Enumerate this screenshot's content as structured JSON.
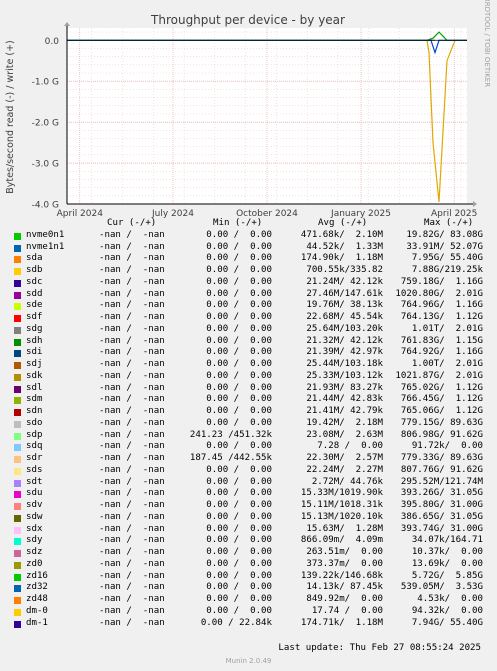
{
  "chart_data": {
    "type": "line",
    "title": "Throughput per device - by year",
    "ylabel": "Bytes/second read (-) / write (+)",
    "side_label": "RRDTOOL / TOBI OETIKER",
    "y_ticks": [
      {
        "v": 0,
        "label": "0.0"
      },
      {
        "v": -1,
        "label": "-1.0 G"
      },
      {
        "v": -2,
        "label": "-2.0 G"
      },
      {
        "v": -3,
        "label": "-3.0 G"
      },
      {
        "v": -4,
        "label": "-4.0 G"
      }
    ],
    "ylim": [
      -4,
      0.3
    ],
    "x_ticks": [
      "April 2024",
      "July 2024",
      "October 2024",
      "January 2025",
      "April 2025"
    ],
    "x_tick_fracs": [
      0.032,
      0.265,
      0.5,
      0.735,
      0.968
    ],
    "grid": true,
    "series": [
      {
        "name": "sda read",
        "color": "#e0a800",
        "x": [
          0.0,
          0.9,
          0.905,
          0.915,
          0.93,
          0.95,
          0.97,
          1.0
        ],
        "values": [
          0.0,
          0.0,
          -0.3,
          -2.5,
          -3.95,
          -0.5,
          0.0,
          0.0
        ]
      },
      {
        "name": "sda write",
        "color": "#00a000",
        "x": [
          0.0,
          0.9,
          0.915,
          0.93,
          0.95,
          1.0
        ],
        "values": [
          0.0,
          0.0,
          0.05,
          0.2,
          0.0,
          0.0
        ]
      },
      {
        "name": "nvme read",
        "color": "#0044cc",
        "x": [
          0.0,
          0.91,
          0.92,
          0.93,
          1.0
        ],
        "values": [
          0.0,
          0.0,
          -0.3,
          0.0,
          0.0
        ]
      }
    ],
    "legend_headers": {
      "cur": "Cur (-/+)",
      "min": "Min (-/+)",
      "avg": "Avg (-/+)",
      "max": "Max (-/+)"
    },
    "legend": [
      {
        "name": "nvme0n1",
        "color": "#00cc00",
        "cur": "-nan /  -nan",
        "min": "0.00 /  0.00",
        "avg": "471.68k/  2.10M",
        "max": "19.82G/ 83.08G"
      },
      {
        "name": "nvme1n1",
        "color": "#0066b3",
        "cur": "-nan /  -nan",
        "min": "0.00 /  0.00",
        "avg": "44.52k/  1.33M",
        "max": "33.91M/ 52.07G"
      },
      {
        "name": "sda",
        "color": "#ff8000",
        "cur": "-nan /  -nan",
        "min": "0.00 /  0.00",
        "avg": "174.90k/  1.18M",
        "max": "7.95G/ 55.40G"
      },
      {
        "name": "sdb",
        "color": "#ffcc00",
        "cur": "-nan /  -nan",
        "min": "0.00 /  0.00",
        "avg": "700.55k/335.82",
        "max": "7.88G/219.25k"
      },
      {
        "name": "sdc",
        "color": "#330099",
        "cur": "-nan /  -nan",
        "min": "0.00 /  0.00",
        "avg": "21.24M/ 42.12k",
        "max": "759.18G/  1.16G"
      },
      {
        "name": "sdd",
        "color": "#990099",
        "cur": "-nan /  -nan",
        "min": "0.00 /  0.00",
        "avg": "27.46M/147.61k",
        "max": "1020.80G/  2.01G"
      },
      {
        "name": "sde",
        "color": "#ccff00",
        "cur": "-nan /  -nan",
        "min": "0.00 /  0.00",
        "avg": "19.76M/ 38.13k",
        "max": "764.96G/  1.16G"
      },
      {
        "name": "sdf",
        "color": "#ff0000",
        "cur": "-nan /  -nan",
        "min": "0.00 /  0.00",
        "avg": "22.68M/ 45.54k",
        "max": "764.13G/  1.12G"
      },
      {
        "name": "sdg",
        "color": "#808080",
        "cur": "-nan /  -nan",
        "min": "0.00 /  0.00",
        "avg": "25.64M/103.20k",
        "max": "1.01T/  2.01G"
      },
      {
        "name": "sdh",
        "color": "#008f00",
        "cur": "-nan /  -nan",
        "min": "0.00 /  0.00",
        "avg": "21.32M/ 42.12k",
        "max": "761.83G/  1.15G"
      },
      {
        "name": "sdi",
        "color": "#00487d",
        "cur": "-nan /  -nan",
        "min": "0.00 /  0.00",
        "avg": "21.39M/ 42.97k",
        "max": "764.92G/  1.16G"
      },
      {
        "name": "sdj",
        "color": "#b35a00",
        "cur": "-nan /  -nan",
        "min": "0.00 /  0.00",
        "avg": "25.44M/103.18k",
        "max": "1.00T/  2.01G"
      },
      {
        "name": "sdk",
        "color": "#b38f00",
        "cur": "-nan /  -nan",
        "min": "0.00 /  0.00",
        "avg": "25.33M/103.12k",
        "max": "1021.87G/  2.01G"
      },
      {
        "name": "sdl",
        "color": "#6b006b",
        "cur": "-nan /  -nan",
        "min": "0.00 /  0.00",
        "avg": "21.93M/ 83.27k",
        "max": "765.02G/  1.12G"
      },
      {
        "name": "sdm",
        "color": "#8fb300",
        "cur": "-nan /  -nan",
        "min": "0.00 /  0.00",
        "avg": "21.44M/ 42.83k",
        "max": "766.45G/  1.12G"
      },
      {
        "name": "sdn",
        "color": "#b30000",
        "cur": "-nan /  -nan",
        "min": "0.00 /  0.00",
        "avg": "21.41M/ 42.79k",
        "max": "765.06G/  1.12G"
      },
      {
        "name": "sdo",
        "color": "#bebebe",
        "cur": "-nan /  -nan",
        "min": "0.00 /  0.00",
        "avg": "19.42M/  2.18M",
        "max": "779.15G/ 89.63G"
      },
      {
        "name": "sdp",
        "color": "#80ff80",
        "cur": "-nan /  -nan",
        "min": "241.23 /451.32k",
        "avg": "23.08M/  2.63M",
        "max": "806.98G/ 91.62G"
      },
      {
        "name": "sdq",
        "color": "#80c9ff",
        "cur": "-nan /  -nan",
        "min": "0.00 /  0.00",
        "avg": "7.28 /  0.00",
        "max": "91.72k/  0.00"
      },
      {
        "name": "sdr",
        "color": "#ffc080",
        "cur": "-nan /  -nan",
        "min": "187.45 /442.55k",
        "avg": "22.30M/  2.57M",
        "max": "779.33G/ 89.63G"
      },
      {
        "name": "sds",
        "color": "#ffe680",
        "cur": "-nan /  -nan",
        "min": "0.00 /  0.00",
        "avg": "22.24M/  2.27M",
        "max": "807.76G/ 91.62G"
      },
      {
        "name": "sdt",
        "color": "#aa80ff",
        "cur": "-nan /  -nan",
        "min": "0.00 /  0.00",
        "avg": "2.72M/ 44.76k",
        "max": "295.52M/121.74M"
      },
      {
        "name": "sdu",
        "color": "#ee00cc",
        "cur": "-nan /  -nan",
        "min": "0.00 /  0.00",
        "avg": "15.33M/1019.90k",
        "max": "393.26G/ 31.05G"
      },
      {
        "name": "sdv",
        "color": "#ff8080",
        "cur": "-nan /  -nan",
        "min": "0.00 /  0.00",
        "avg": "15.11M/1018.31k",
        "max": "395.80G/ 31.00G"
      },
      {
        "name": "sdw",
        "color": "#666600",
        "cur": "-nan /  -nan",
        "min": "0.00 /  0.00",
        "avg": "15.13M/1020.10k",
        "max": "386.65G/ 31.05G"
      },
      {
        "name": "sdx",
        "color": "#ffbfff",
        "cur": "-nan /  -nan",
        "min": "0.00 /  0.00",
        "avg": "15.63M/  1.28M",
        "max": "393.74G/ 31.00G"
      },
      {
        "name": "sdy",
        "color": "#00ffcc",
        "cur": "-nan /  -nan",
        "min": "0.00 /  0.00",
        "avg": "866.09m/  4.09m",
        "max": "34.07k/164.71"
      },
      {
        "name": "sdz",
        "color": "#cc6699",
        "cur": "-nan /  -nan",
        "min": "0.00 /  0.00",
        "avg": "263.51m/  0.00",
        "max": "10.37k/  0.00"
      },
      {
        "name": "zd0",
        "color": "#999900",
        "cur": "-nan /  -nan",
        "min": "0.00 /  0.00",
        "avg": "373.37m/  0.00",
        "max": "13.69k/  0.00"
      },
      {
        "name": "zd16",
        "color": "#00cc00",
        "cur": "-nan /  -nan",
        "min": "0.00 /  0.00",
        "avg": "139.22k/146.68k",
        "max": "5.72G/  5.85G"
      },
      {
        "name": "zd32",
        "color": "#0066b3",
        "cur": "-nan /  -nan",
        "min": "0.00 /  0.00",
        "avg": "14.13k/ 87.45k",
        "max": "539.05M/  3.53G"
      },
      {
        "name": "zd48",
        "color": "#ff8000",
        "cur": "-nan /  -nan",
        "min": "0.00 /  0.00",
        "avg": "849.92m/  0.00",
        "max": "4.53k/  0.00"
      },
      {
        "name": "dm-0",
        "color": "#ffcc00",
        "cur": "-nan /  -nan",
        "min": "0.00 /  0.00",
        "avg": "17.74 /  0.00",
        "max": "94.32k/  0.00"
      },
      {
        "name": "dm-1",
        "color": "#330099",
        "cur": "-nan /  -nan",
        "min": "0.00 / 22.84k",
        "avg": "174.71k/  1.18M",
        "max": "7.94G/ 55.40G"
      }
    ]
  },
  "last_update": "Last update: Thu Feb 27 08:55:24 2025",
  "footer": "Munin 2.0.49"
}
